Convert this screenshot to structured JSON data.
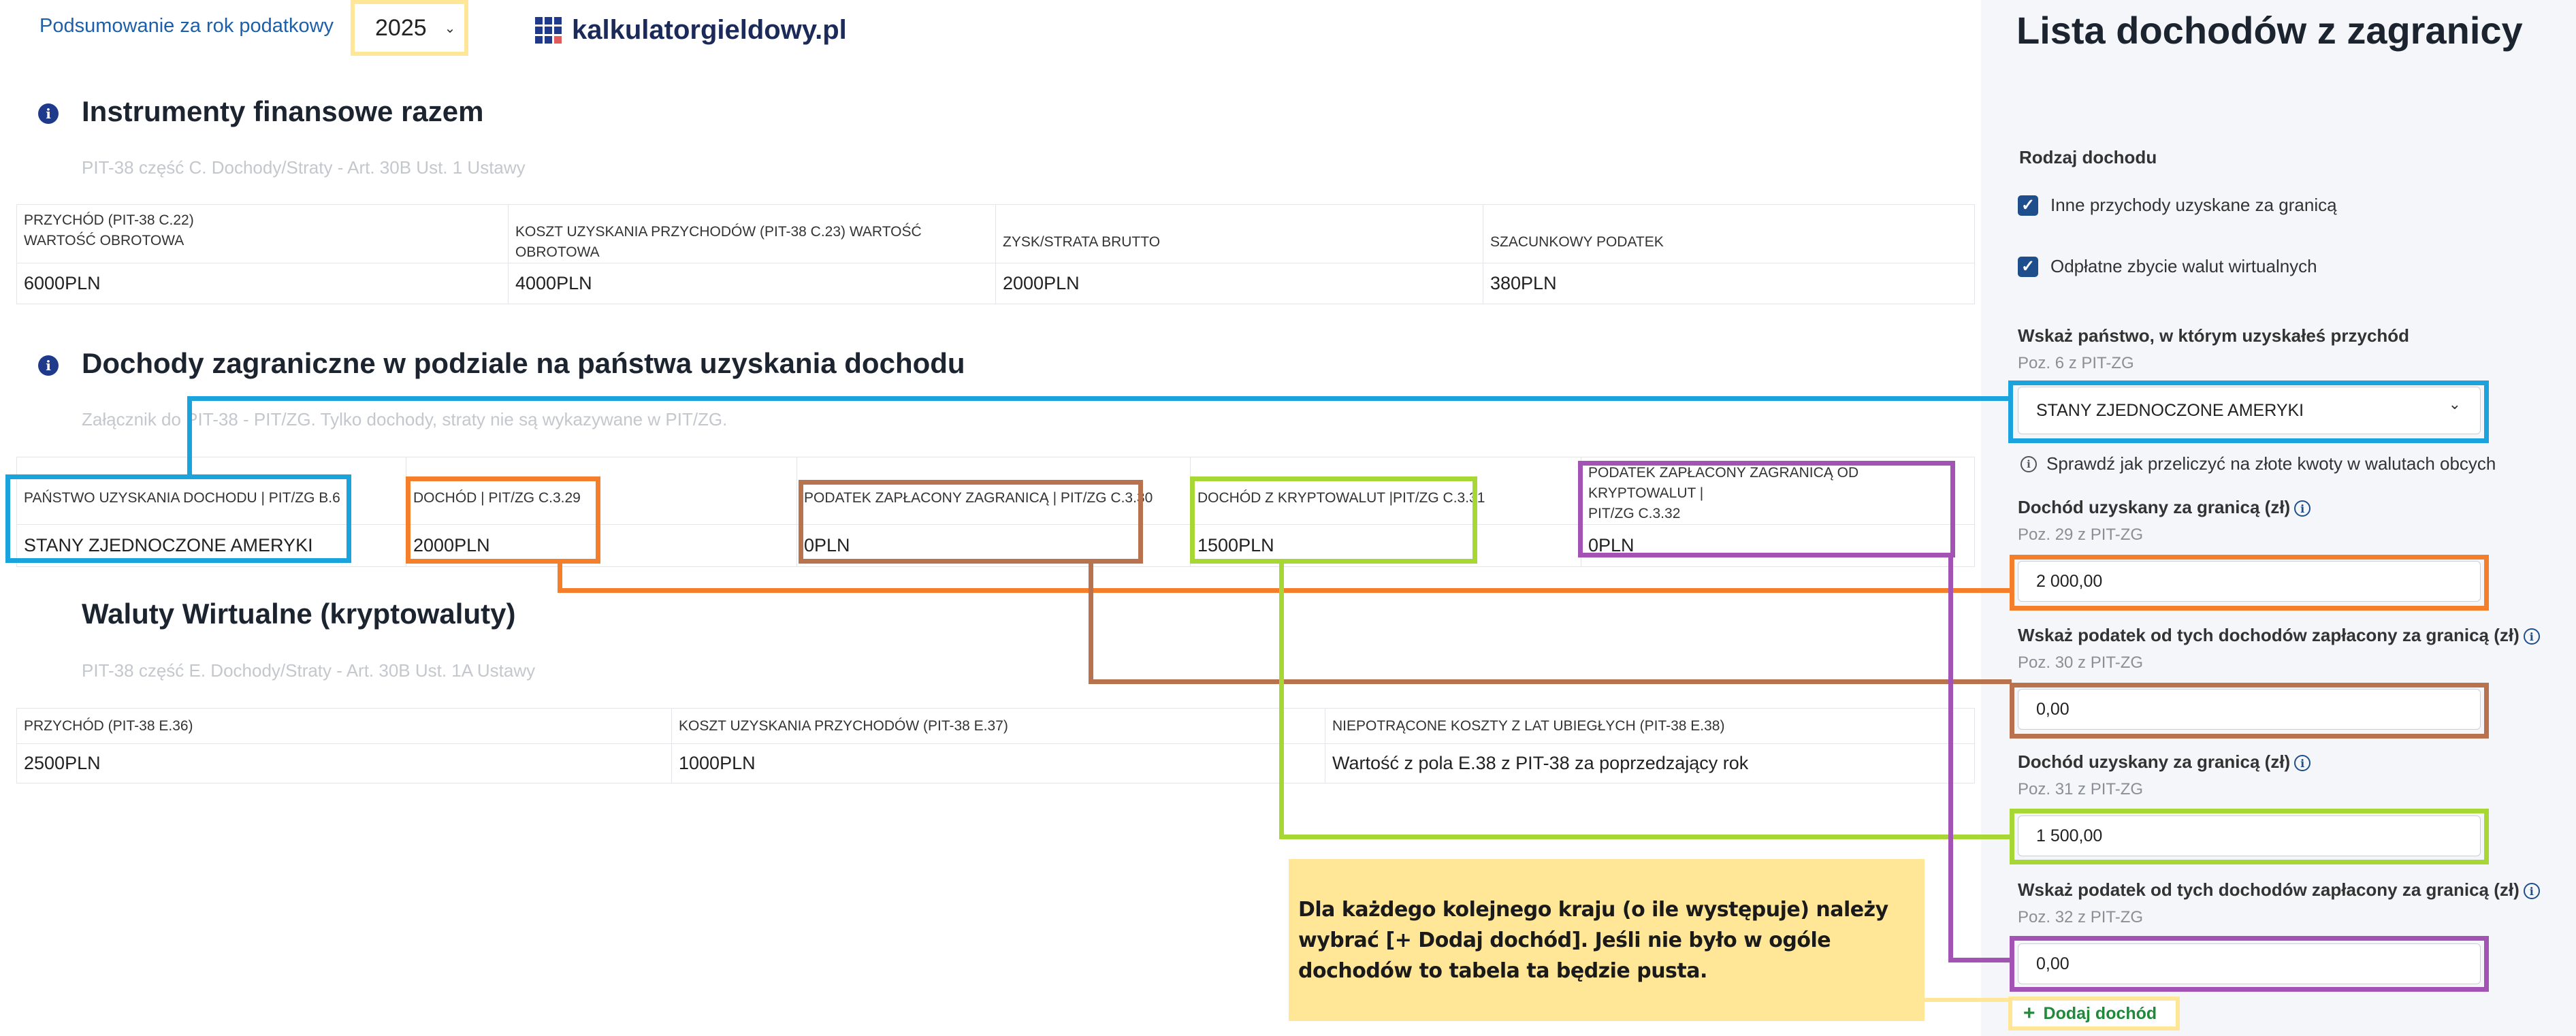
{
  "header": {
    "summary_label": "Podsumowanie za rok podatkowy",
    "year": "2025",
    "logo_text": "kalkulatorgieldowy.pl"
  },
  "section1": {
    "title": "Instrumenty finansowe razem",
    "subtitle": "PIT-38 część C. Dochody/Straty - Art. 30B Ust. 1 Ustawy",
    "headers": [
      "PRZYCHÓD (PIT-38 C.22)",
      "WARTOŚĆ OBROTOWA",
      "KOSZT UZYSKANIA PRZYCHODÓW (PIT-38 C.23) WARTOŚĆ OBROTOWA",
      "ZYSK/STRATA BRUTTO",
      "SZACUNKOWY PODATEK"
    ],
    "values": [
      "6000PLN",
      "4000PLN",
      "2000PLN",
      "380PLN"
    ]
  },
  "section2": {
    "title": "Dochody zagraniczne w podziale na państwa uzyskania dochodu",
    "subtitle": "Załącznik do PIT-38 - PIT/ZG. Tylko dochody, straty nie są wykazywane w PIT/ZG.",
    "headers": [
      "PAŃSTWO UZYSKANIA DOCHODU | PIT/ZG B.6",
      "DOCHÓD | PIT/ZG C.3.29",
      "PODATEK ZAPŁACONY ZAGRANICĄ | PIT/ZG C.3.30",
      "DOCHÓD Z KRYPTOWALUT |PIT/ZG C.3.31",
      "PODATEK ZAPŁACONY ZAGRANICĄ OD KRYPTOWALUT |",
      "PIT/ZG C.3.32"
    ],
    "values": [
      "STANY ZJEDNOCZONE AMERYKI",
      "2000PLN",
      "0PLN",
      "1500PLN",
      "0PLN"
    ]
  },
  "section3": {
    "title": "Waluty Wirtualne (kryptowaluty)",
    "subtitle": "PIT-38 część E. Dochody/Straty - Art. 30B Ust. 1A Ustawy",
    "headers": [
      "PRZYCHÓD (PIT-38 E.36)",
      "KOSZT UZYSKANIA PRZYCHODÓW (PIT-38 E.37)",
      "NIEPOTRĄCONE KOSZTY Z LAT UBIEGŁYCH (PIT-38 E.38)"
    ],
    "values": [
      "2500PLN",
      "1000PLN",
      "Wartość z pola E.38 z PIT-38 za poprzedzający rok"
    ]
  },
  "panel": {
    "title": "Lista dochodów z zagranicy",
    "income_type_label": "Rodzaj dochodu",
    "checkbox1": "Inne przychody uzyskane za granicą",
    "checkbox2": "Odpłatne zbycie walut wirtualnych",
    "country_label": "Wskaż państwo, w którym uzyskałeś przychód",
    "country_sub": "Poz. 6 z PIT-ZG",
    "country_value": "STANY ZJEDNOCZONE AMERYKI",
    "convert_hint": "Sprawdź jak przeliczyć na złote kwoty w walutach obcych",
    "f1_label": "Dochód uzyskany za granicą (zł)",
    "f1_sub": "Poz. 29 z PIT-ZG",
    "f1_value": "2 000,00",
    "f2_label": "Wskaż podatek od tych dochodów zapłacony za granicą (zł)",
    "f2_sub": "Poz. 30 z PIT-ZG",
    "f2_value": "0,00",
    "f3_label": "Dochód uzyskany za granicą (zł)",
    "f3_sub": "Poz. 31 z PIT-ZG",
    "f3_value": "1 500,00",
    "f4_label": "Wskaż podatek od tych dochodów zapłacony za granicą (zł)",
    "f4_sub": "Poz. 32 z PIT-ZG",
    "f4_value": "0,00",
    "add_button": "Dodaj dochód"
  },
  "note": {
    "text": "Dla każdego kolejnego kraju (o ile występuje) należy wybrać [+ Dodaj dochód]. Jeśli nie było w ogóle dochodów to tabela ta będzie pusta."
  },
  "colors": {
    "blue": "#1aa3dc",
    "orange": "#f47e2a",
    "brown": "#b8734e",
    "green": "#a6d735",
    "purple": "#a353b3",
    "yellow": "#ffe797"
  }
}
